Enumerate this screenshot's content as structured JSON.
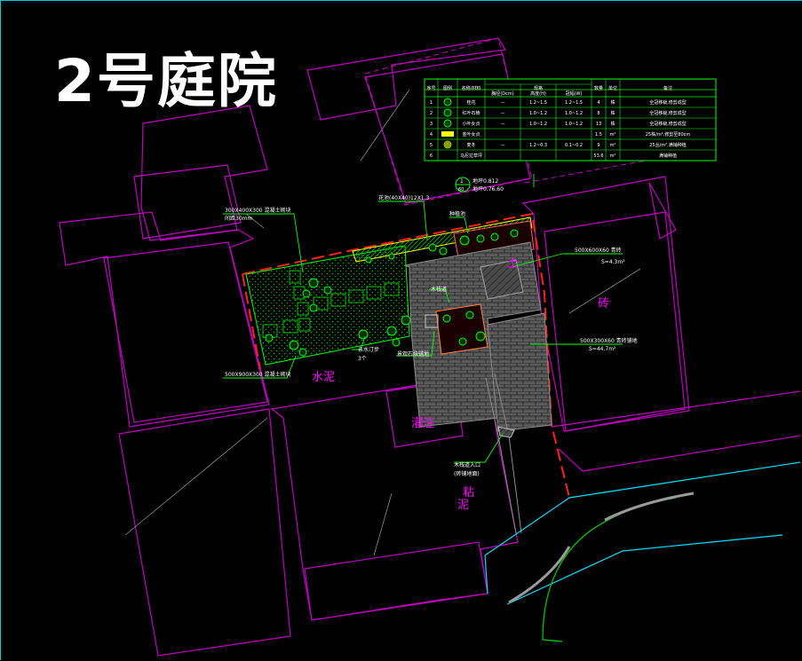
{
  "title": "2号庭院",
  "colors": {
    "background": "#000000",
    "building_outline": "#c000c0",
    "label_magenta": "#ff00ff",
    "leader_green": "#00ff00",
    "boundary_red": "#ff2020",
    "road_cyan": "#00e0ff",
    "paving_gray": "#6a6a6a",
    "planting_green": "#00c000"
  },
  "plan_labels": {
    "cement": "水泥",
    "right_block": "砖",
    "mid_block": "土",
    "lower_block": "灌注",
    "lower_block2a": "粘",
    "lower_block2b": "泥",
    "section_num": "1",
    "section_sheet": "60",
    "section_note_1": "地坪0.812",
    "section_note_2": "地坪0.76.60"
  },
  "annotations": [
    "300X400X300 混凝土砌块",
    "间距30mm",
    "500X900X300 混凝土砌块",
    "花池(40X40)12X1.3",
    "种植池",
    "木栈道",
    "500X600X60 青砖",
    "S=4.3m²",
    "500X300X60 青砖铺地",
    "S=44.7m²",
    "亲水汀步",
    "3个",
    "景观石块铺地",
    "木栈道入口",
    "(砖铺地面)"
  ],
  "legend_table": {
    "headers": [
      "序号",
      "图例",
      "名称/材料",
      "规格",
      "数量",
      "单位",
      "备注"
    ],
    "subheaders": [
      "胸径(Dcm)",
      "高度(H)",
      "冠幅(W)"
    ],
    "rows": [
      {
        "no": "1",
        "name": "桂花",
        "d": "—",
        "h": "1.2~1.5",
        "w": "1.2~1.5",
        "qty": "4",
        "unit": "株",
        "note": "全冠移栽,修剪成型"
      },
      {
        "no": "2",
        "name": "红叶石楠",
        "d": "—",
        "h": "1.0~1.2",
        "w": "1.0~1.2",
        "qty": "8",
        "unit": "株",
        "note": "全冠移栽,修剪成型"
      },
      {
        "no": "3",
        "name": "小叶女贞",
        "d": "—",
        "h": "1.0~1.2",
        "w": "1.0~1.2",
        "qty": "13",
        "unit": "株",
        "note": "全冠移栽,修剪成型"
      },
      {
        "no": "4",
        "name": "金叶女贞",
        "d": "",
        "h": "",
        "w": "",
        "qty": "1.5",
        "unit": "m²",
        "note": "25株/m²,修剪至80cm"
      },
      {
        "no": "5",
        "name": "麦冬",
        "d": "—",
        "h": "1.2~0.3",
        "w": "0.1~0.2",
        "qty": "9",
        "unit": "m²",
        "note": "25丛/m²,满铺种植"
      },
      {
        "no": "6",
        "name": "马尼拉草坪",
        "d": "",
        "h": "",
        "w": "",
        "qty": "53.6",
        "unit": "m²",
        "note": "满铺种植"
      }
    ]
  }
}
